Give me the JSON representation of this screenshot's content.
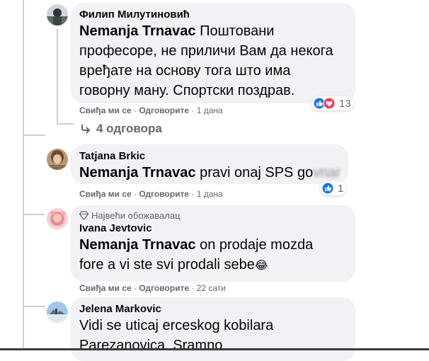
{
  "comments": [
    {
      "author": "Филип Милутиновић",
      "mention": "Nemanja Trnavac",
      "line1": " Поштовани",
      "line2": "професоре, не приличи Вам да некога",
      "line3": "вређате на основу тога што има",
      "line4": "говорну ману. Спортски поздрав.",
      "like_label": "Свиђа ми се",
      "reply_label": "Одговорите",
      "time": "1 дана",
      "reaction_count": "13",
      "replies_label": "4 одговора"
    },
    {
      "author": "Tatjana Brkic",
      "mention": "Nemanja Trnavac",
      "text": " pravi onaj SPS go",
      "text_obscured": "vnar",
      "like_label": "Свиђа ми се",
      "reply_label": "Одговорите",
      "time": "1 дана",
      "reaction_count": "1"
    },
    {
      "badge": "Највећи обожавалац",
      "author": "Ivana Jevtovic",
      "mention": "Nemanja Trnavac",
      "line1": " on prodaje mozda",
      "line2": "fore a vi ste svi prodali sebe",
      "emoji": "😂",
      "like_label": "Свиђа ми се",
      "reply_label": "Одговорите",
      "time": "22 сати"
    },
    {
      "author": "Jelena Markovic",
      "line1": "Vidi se uticaj erceskog kobilara",
      "line2": "Parezanovica. Sramno"
    }
  ],
  "separator": "·",
  "colors": {
    "like_blue": "#1877f2",
    "love_red": "#f33e58",
    "bubble": "#f0f2f5",
    "meta": "#65676b"
  }
}
